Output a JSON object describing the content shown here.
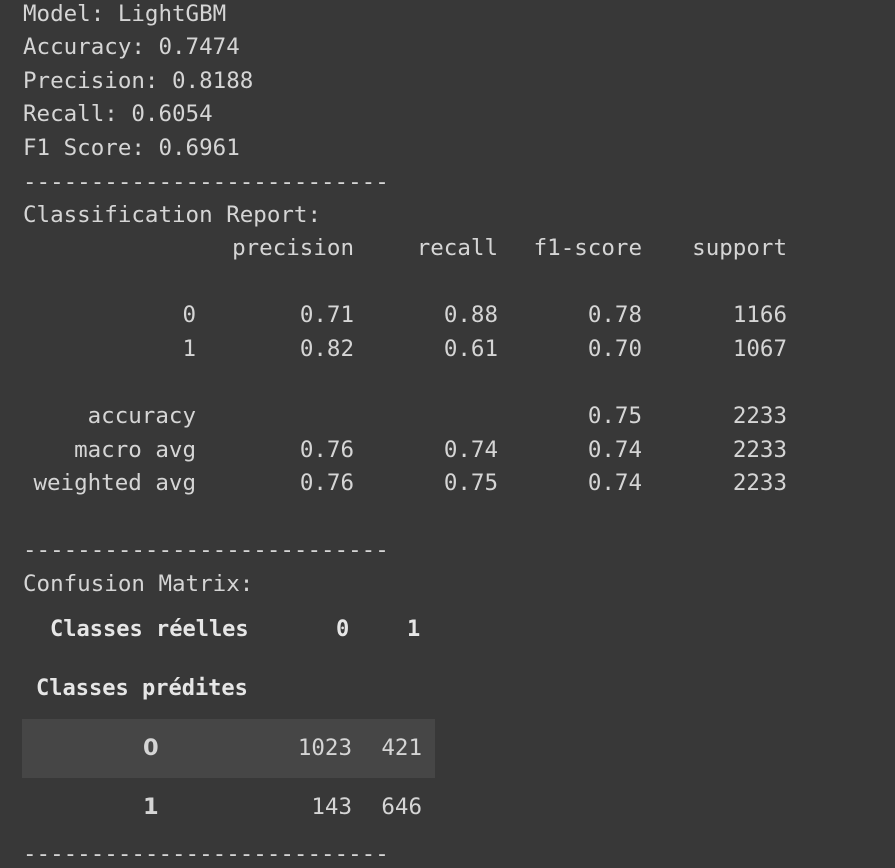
{
  "summary": {
    "model": "Model: LightGBM",
    "accuracy": "Accuracy: 0.7474",
    "precision": "Precision: 0.8188",
    "recall": "Recall: 0.6054",
    "f1": "F1 Score: 0.6961"
  },
  "separator": "---------------------------",
  "report": {
    "title": "Classification Report:",
    "headers": [
      "precision",
      "recall",
      "f1-score",
      "support"
    ],
    "rows": [
      {
        "label": "0",
        "precision": "0.71",
        "recall": "0.88",
        "f1": "0.78",
        "support": "1166"
      },
      {
        "label": "1",
        "precision": "0.82",
        "recall": "0.61",
        "f1": "0.70",
        "support": "1067"
      }
    ],
    "summary_rows": [
      {
        "label": "accuracy",
        "precision": "",
        "recall": "",
        "f1": "0.75",
        "support": "2233"
      },
      {
        "label": "macro avg",
        "precision": "0.76",
        "recall": "0.74",
        "f1": "0.74",
        "support": "2233"
      },
      {
        "label": "weighted avg",
        "precision": "0.76",
        "recall": "0.75",
        "f1": "0.74",
        "support": "2233"
      }
    ]
  },
  "confusion": {
    "title": "Confusion Matrix:",
    "col_header_label": "Classes réelles",
    "col_headers": [
      "0",
      "1"
    ],
    "row_header_label": "Classes prédites",
    "rows": [
      {
        "label": "0",
        "values": [
          "1023",
          "421"
        ]
      },
      {
        "label": "1",
        "values": [
          "143",
          "646"
        ]
      }
    ]
  }
}
